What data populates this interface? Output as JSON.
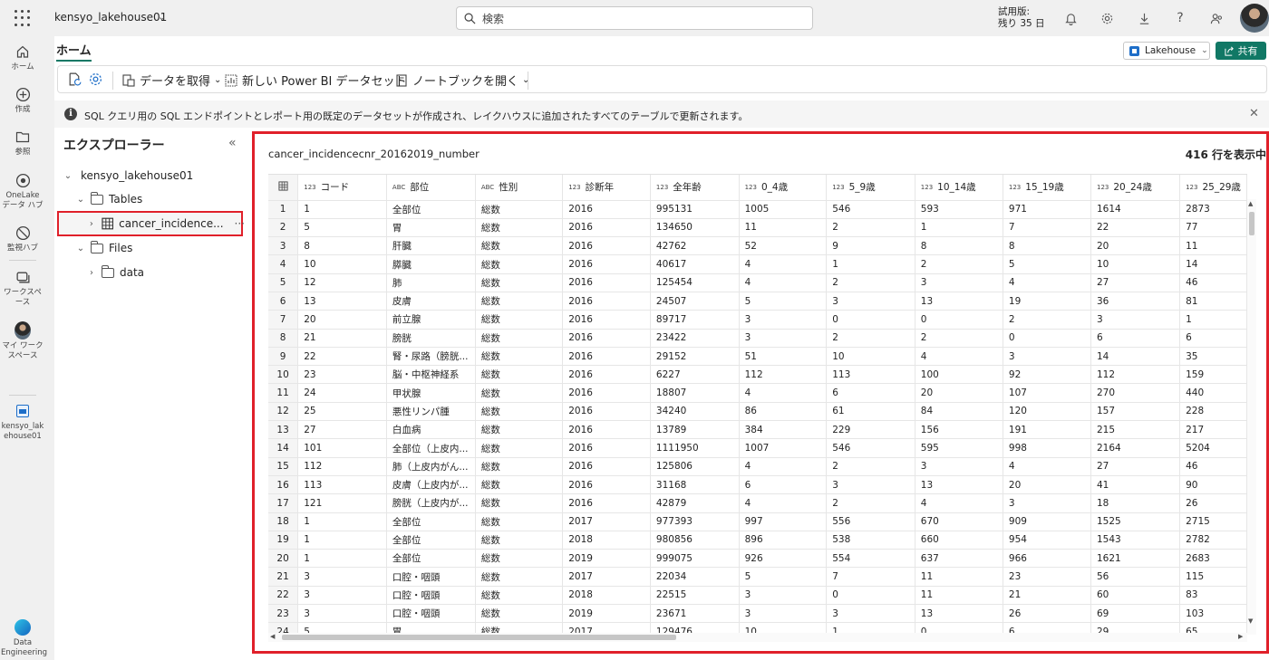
{
  "topbar": {
    "workspace_name": "kensyo_lakehouse01",
    "search_placeholder": "検索",
    "trial_line1": "試用版:",
    "trial_line2": "残り 35 日"
  },
  "rail": {
    "items": [
      {
        "label": "ホーム",
        "icon": "home-icon"
      },
      {
        "label": "作成",
        "icon": "create-icon"
      },
      {
        "label": "参照",
        "icon": "browse-icon"
      },
      {
        "label": "OneLake データ ハブ",
        "icon": "onelake-icon"
      },
      {
        "label": "監視ハブ",
        "icon": "monitor-icon"
      },
      {
        "label": "ワークスペース",
        "icon": "workspaces-icon"
      },
      {
        "label": "マイ ワークスペース",
        "icon": "my-workspace-icon"
      },
      {
        "label": "kensyo_lakehouse01",
        "icon": "lakehouse-icon"
      }
    ],
    "bottom_label": "Data Engineering"
  },
  "ribbon": {
    "tab_home": "ホーム",
    "get_data": "データを取得",
    "new_dataset": "新しい Power BI データセット",
    "open_notebook": "ノートブックを開く",
    "lakehouse_btn": "Lakehouse",
    "share_btn": "共有"
  },
  "info": {
    "message": "SQL クエリ用の SQL エンドポイントとレポート用の既定のデータセットが作成され、レイクハウスに追加されたすべてのテーブルで更新されます。"
  },
  "explorer": {
    "title": "エクスプローラー",
    "root": "kensyo_lakehouse01",
    "tables": "Tables",
    "table_item": "cancer_incidence...",
    "files": "Files",
    "data_folder": "data"
  },
  "preview": {
    "table_name": "cancer_incidencecnr_20162019_number",
    "row_count": "416 行を表示中",
    "columns": [
      {
        "type": "123",
        "name": "コード"
      },
      {
        "type": "ABC",
        "name": "部位"
      },
      {
        "type": "ABC",
        "name": "性別"
      },
      {
        "type": "123",
        "name": "診断年"
      },
      {
        "type": "123",
        "name": "全年齢"
      },
      {
        "type": "123",
        "name": "0_4歳"
      },
      {
        "type": "123",
        "name": "5_9歳"
      },
      {
        "type": "123",
        "name": "10_14歳"
      },
      {
        "type": "123",
        "name": "15_19歳"
      },
      {
        "type": "123",
        "name": "20_24歳"
      },
      {
        "type": "123",
        "name": "25_29歳"
      }
    ],
    "rows": [
      [
        "1",
        "1",
        "全部位",
        "総数",
        "2016",
        "995131",
        "1005",
        "546",
        "593",
        "971",
        "1614",
        "2873"
      ],
      [
        "2",
        "5",
        "胃",
        "総数",
        "2016",
        "134650",
        "11",
        "2",
        "1",
        "7",
        "22",
        "77"
      ],
      [
        "3",
        "8",
        "肝臓",
        "総数",
        "2016",
        "42762",
        "52",
        "9",
        "8",
        "8",
        "20",
        "11"
      ],
      [
        "4",
        "10",
        "膵臓",
        "総数",
        "2016",
        "40617",
        "4",
        "1",
        "2",
        "5",
        "10",
        "14"
      ],
      [
        "5",
        "12",
        "肺",
        "総数",
        "2016",
        "125454",
        "4",
        "2",
        "3",
        "4",
        "27",
        "46"
      ],
      [
        "6",
        "13",
        "皮膚",
        "総数",
        "2016",
        "24507",
        "5",
        "3",
        "13",
        "19",
        "36",
        "81"
      ],
      [
        "7",
        "20",
        "前立腺",
        "総数",
        "2016",
        "89717",
        "3",
        "0",
        "0",
        "2",
        "3",
        "1"
      ],
      [
        "8",
        "21",
        "膀胱",
        "総数",
        "2016",
        "23422",
        "3",
        "2",
        "2",
        "0",
        "6",
        "6"
      ],
      [
        "9",
        "22",
        "腎・尿路（膀胱...",
        "総数",
        "2016",
        "29152",
        "51",
        "10",
        "4",
        "3",
        "14",
        "35"
      ],
      [
        "10",
        "23",
        "脳・中枢神経系",
        "総数",
        "2016",
        "6227",
        "112",
        "113",
        "100",
        "92",
        "112",
        "159"
      ],
      [
        "11",
        "24",
        "甲状腺",
        "総数",
        "2016",
        "18807",
        "4",
        "6",
        "20",
        "107",
        "270",
        "440"
      ],
      [
        "12",
        "25",
        "悪性リンパ腫",
        "総数",
        "2016",
        "34240",
        "86",
        "61",
        "84",
        "120",
        "157",
        "228"
      ],
      [
        "13",
        "27",
        "白血病",
        "総数",
        "2016",
        "13789",
        "384",
        "229",
        "156",
        "191",
        "215",
        "217"
      ],
      [
        "14",
        "101",
        "全部位（上皮内...",
        "総数",
        "2016",
        "1111950",
        "1007",
        "546",
        "595",
        "998",
        "2164",
        "5204"
      ],
      [
        "15",
        "112",
        "肺（上皮内がん...",
        "総数",
        "2016",
        "125806",
        "4",
        "2",
        "3",
        "4",
        "27",
        "46"
      ],
      [
        "16",
        "113",
        "皮膚（上皮内が...",
        "総数",
        "2016",
        "31168",
        "6",
        "3",
        "13",
        "20",
        "41",
        "90"
      ],
      [
        "17",
        "121",
        "膀胱（上皮内が...",
        "総数",
        "2016",
        "42879",
        "4",
        "2",
        "4",
        "3",
        "18",
        "26"
      ],
      [
        "18",
        "1",
        "全部位",
        "総数",
        "2017",
        "977393",
        "997",
        "556",
        "670",
        "909",
        "1525",
        "2715"
      ],
      [
        "19",
        "1",
        "全部位",
        "総数",
        "2018",
        "980856",
        "896",
        "538",
        "660",
        "954",
        "1543",
        "2782"
      ],
      [
        "20",
        "1",
        "全部位",
        "総数",
        "2019",
        "999075",
        "926",
        "554",
        "637",
        "966",
        "1621",
        "2683"
      ],
      [
        "21",
        "3",
        "口腔・咽頭",
        "総数",
        "2017",
        "22034",
        "5",
        "7",
        "11",
        "23",
        "56",
        "115"
      ],
      [
        "22",
        "3",
        "口腔・咽頭",
        "総数",
        "2018",
        "22515",
        "3",
        "0",
        "11",
        "21",
        "60",
        "83"
      ],
      [
        "23",
        "3",
        "口腔・咽頭",
        "総数",
        "2019",
        "23671",
        "3",
        "3",
        "13",
        "26",
        "69",
        "103"
      ],
      [
        "24",
        "5",
        "胃",
        "総数",
        "2017",
        "129476",
        "10",
        "1",
        "0",
        "6",
        "29",
        "65"
      ]
    ]
  }
}
